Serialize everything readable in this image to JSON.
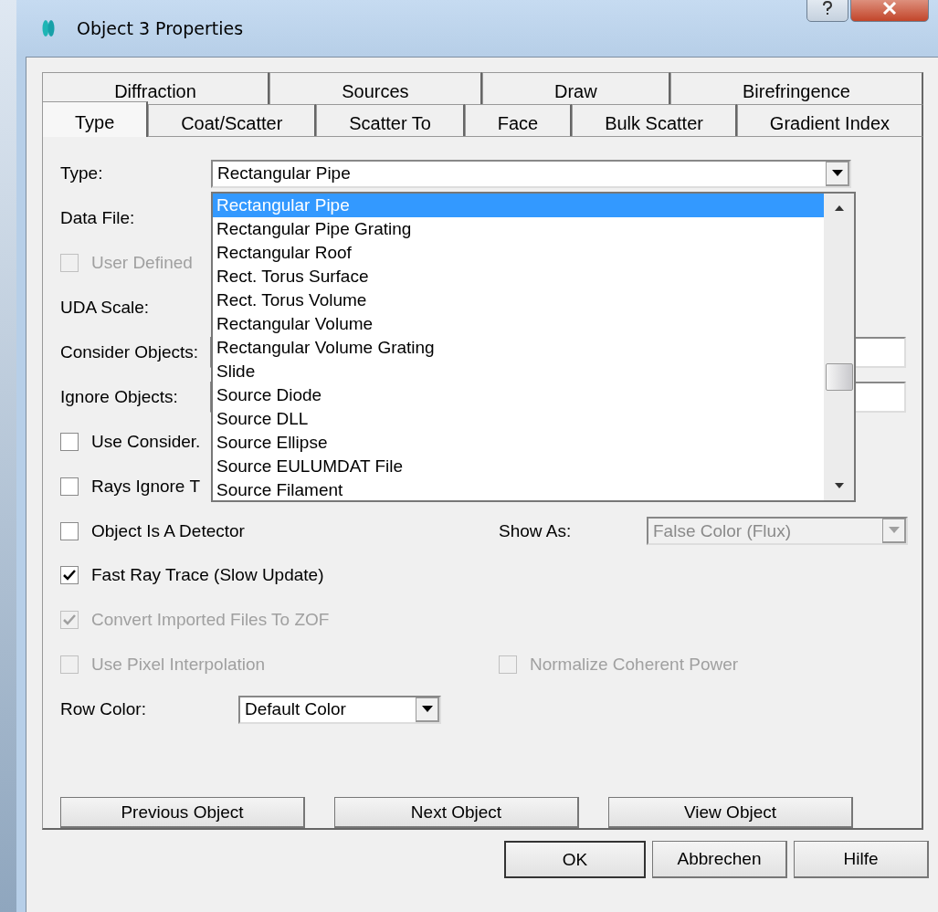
{
  "window": {
    "title": "Object 3 Properties"
  },
  "tabs": [
    [
      {
        "label": "Diffraction",
        "selected": false
      },
      {
        "label": "Sources",
        "selected": false
      },
      {
        "label": "Draw",
        "selected": false
      },
      {
        "label": "Birefringence",
        "selected": false
      }
    ],
    [
      {
        "label": "Type",
        "selected": true
      },
      {
        "label": "Coat/Scatter",
        "selected": false
      },
      {
        "label": "Scatter To",
        "selected": false
      },
      {
        "label": "Face",
        "selected": false
      },
      {
        "label": "Bulk Scatter",
        "selected": false
      },
      {
        "label": "Gradient Index",
        "selected": false
      }
    ]
  ],
  "rows": [
    {
      "kind": "combo",
      "label": "Type:",
      "value": "Rectangular Pipe"
    },
    {
      "kind": "label",
      "label": "Data File:"
    },
    {
      "kind": "check",
      "label": "User Defined",
      "checked": false,
      "disabled": true
    },
    {
      "kind": "label",
      "label": "UDA Scale:"
    },
    {
      "kind": "field",
      "label": "Consider Objects:"
    },
    {
      "kind": "field",
      "label": "Ignore Objects:"
    },
    {
      "kind": "check",
      "label": "Use Consider.",
      "checked": false,
      "disabled": false
    },
    {
      "kind": "check",
      "label": "Rays Ignore T",
      "checked": false,
      "disabled": false
    },
    {
      "kind": "check",
      "label": "Object Is A Detector",
      "checked": false,
      "disabled": false,
      "right": {
        "kind": "combo",
        "label": "Show As:",
        "value": "False Color (Flux)",
        "disabled": true
      }
    },
    {
      "kind": "check",
      "label": "Fast Ray Trace (Slow Update)",
      "checked": true,
      "disabled": false
    },
    {
      "kind": "check",
      "label": "Convert Imported Files To ZOF",
      "checked": true,
      "disabled": true
    },
    {
      "kind": "check",
      "label": "Use Pixel Interpolation",
      "checked": false,
      "disabled": true,
      "right": {
        "kind": "check",
        "label": "Normalize Coherent Power",
        "checked": false,
        "disabled": true
      }
    },
    {
      "kind": "small-combo",
      "label": "Row Color:",
      "value": "Default Color"
    }
  ],
  "dropdown": [
    {
      "label": "Rectangular Pipe",
      "selected": true
    },
    {
      "label": "Rectangular Pipe Grating",
      "selected": false
    },
    {
      "label": "Rectangular Roof",
      "selected": false
    },
    {
      "label": "Rect. Torus Surface",
      "selected": false
    },
    {
      "label": "Rect. Torus Volume",
      "selected": false
    },
    {
      "label": "Rectangular Volume",
      "selected": false
    },
    {
      "label": "Rectangular Volume Grating",
      "selected": false
    },
    {
      "label": "Slide",
      "selected": false
    },
    {
      "label": "Source Diode",
      "selected": false
    },
    {
      "label": "Source DLL",
      "selected": false
    },
    {
      "label": "Source Ellipse",
      "selected": false
    },
    {
      "label": "Source EULUMDAT File",
      "selected": false
    },
    {
      "label": "Source Filament",
      "selected": false
    }
  ],
  "nav_buttons": [
    "Previous Object",
    "Next Object",
    "View Object"
  ],
  "dialog_buttons": [
    "OK",
    "Abbrechen",
    "Hilfe"
  ]
}
